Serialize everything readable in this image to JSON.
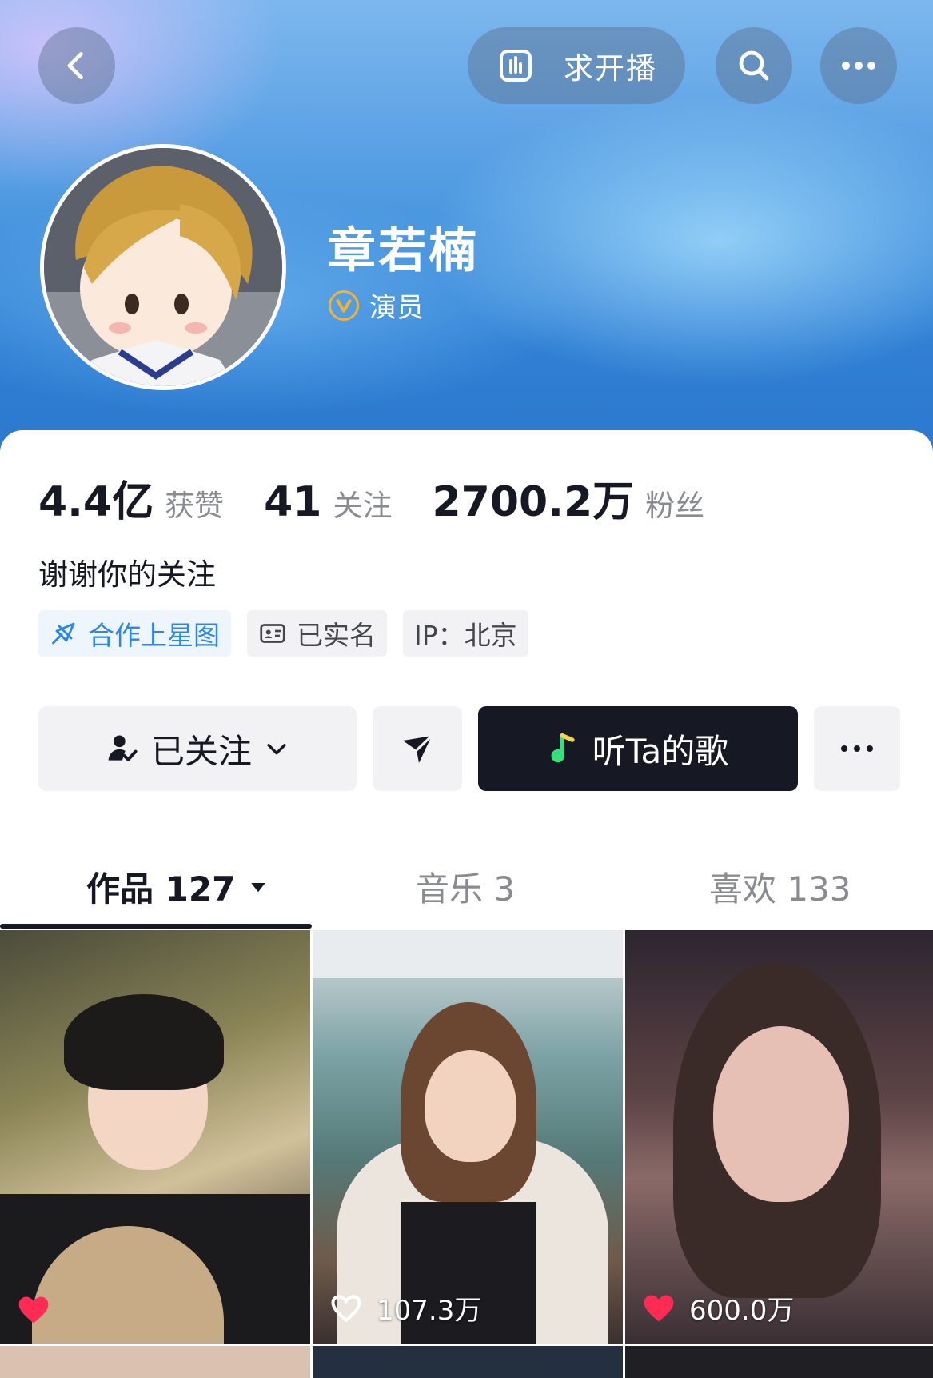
{
  "header": {
    "live_request_label": "求开播",
    "icons": {
      "back": "chevron-left-icon",
      "live": "bar-chart-icon",
      "search": "search-icon",
      "more": "ellipsis-icon"
    }
  },
  "profile": {
    "name": "章若楠",
    "verified_label": "演员",
    "verified_color": "#f2b233"
  },
  "stats": [
    {
      "value": "4.4亿",
      "label": "获赞"
    },
    {
      "value": "41",
      "label": "关注"
    },
    {
      "value": "2700.2万",
      "label": "粉丝"
    }
  ],
  "bio": "谢谢你的关注",
  "tags": {
    "star_map": "合作上星图",
    "real_name": "已实名",
    "ip": "IP：北京"
  },
  "actions": {
    "follow_label": "已关注",
    "music_label": "听Ta的歌"
  },
  "tabs": {
    "works": "作品 127",
    "music": "音乐 3",
    "likes": "喜欢 133"
  },
  "grid": {
    "items": [
      {
        "likes": ""
      },
      {
        "likes": "107.3万"
      },
      {
        "likes": "600.0万"
      }
    ],
    "heart_color": "#fe2c55"
  }
}
